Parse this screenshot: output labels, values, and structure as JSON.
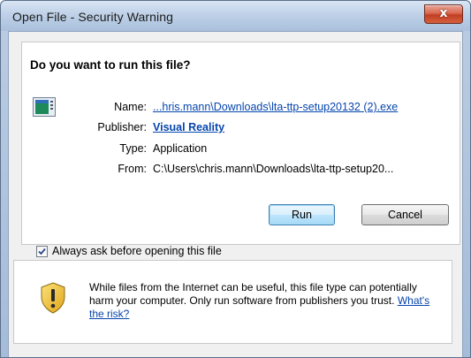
{
  "window": {
    "title": "Open File - Security Warning",
    "close_label": "x"
  },
  "dialog": {
    "question": "Do you want to run this file?",
    "fields": {
      "name_label": "Name:",
      "name_value": "...hris.mann\\Downloads\\lta-ttp-setup20132 (2).exe",
      "publisher_label": "Publisher:",
      "publisher_value": "Visual Reality",
      "type_label": "Type:",
      "type_value": "Application",
      "from_label": "From:",
      "from_value": "C:\\Users\\chris.mann\\Downloads\\lta-ttp-setup20..."
    },
    "buttons": {
      "run_label": "Run",
      "cancel_label": "Cancel"
    },
    "checkbox": {
      "label": "Always ask before opening this file",
      "checked": true
    },
    "warning": {
      "text": "While files from the Internet can be useful, this file type can potentially harm your computer. Only run software from publishers you trust. ",
      "risk_link": "What's the risk?"
    }
  },
  "icons": {
    "file": "application-file-icon",
    "shield": "security-shield-icon",
    "check": "checkmark-icon"
  },
  "colors": {
    "link": "#0645ad",
    "title_gradient_top": "#d9e5f3",
    "close_red": "#c13e24",
    "shield_yellow": "#f2c12e"
  }
}
